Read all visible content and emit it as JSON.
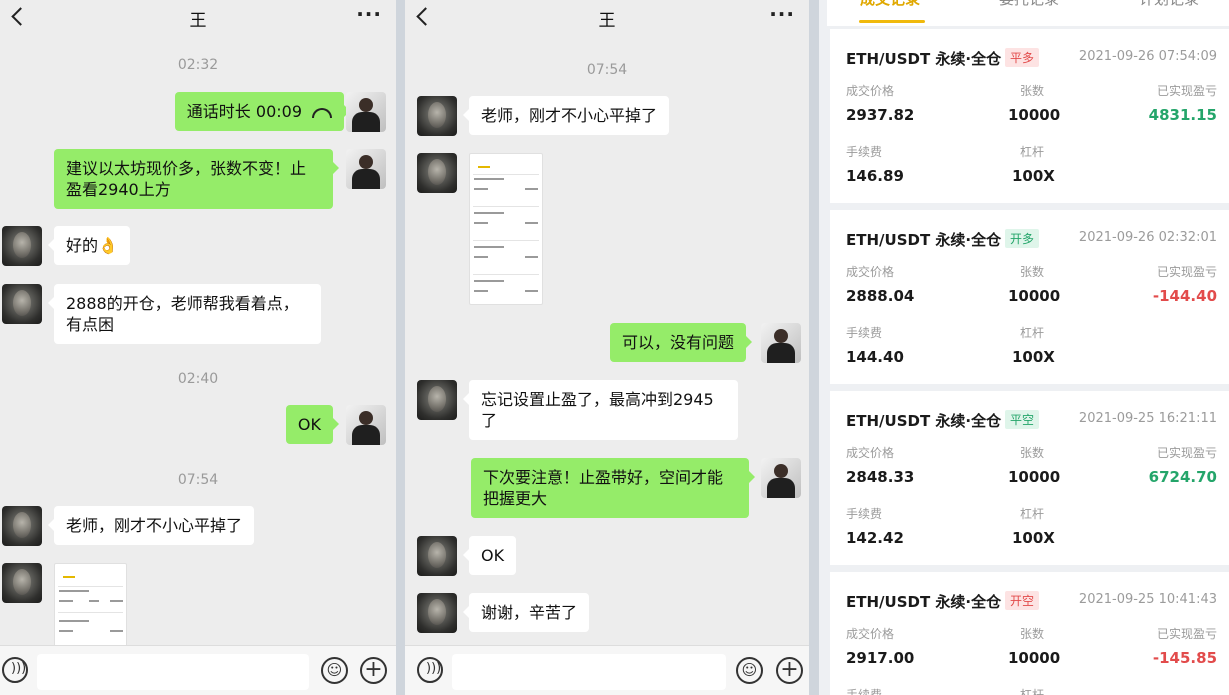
{
  "chat_left": {
    "title": "王",
    "timestamps": [
      "02:32",
      "02:40",
      "07:54"
    ],
    "messages": {
      "call": "通话时长 00:09",
      "suggest": "建议以太坊现价多，张数不变！止盈看2940上方",
      "ok_reply": "好的👌",
      "open_2888": "2888的开仓，老师帮我看着点，有点困",
      "ok": "OK",
      "closed": "老师，刚才不小心平掉了"
    }
  },
  "chat_right": {
    "title": "王",
    "timestamp": "07:54",
    "messages": {
      "closed": "老师，刚才不小心平掉了",
      "fine": "可以，没有问题",
      "forgot": "忘记设置止盈了，最高冲到2945了",
      "advice": "下次要注意！止盈带好，空间才能把握更大",
      "ok": "OK",
      "thanks": "谢谢，辛苦了"
    }
  },
  "records": {
    "tabs": [
      "成交记录",
      "委托记录",
      "计划记录"
    ],
    "labels": {
      "price": "成交价格",
      "qty": "张数",
      "pnl": "已实现盈亏",
      "fee": "手续费",
      "lev": "杠杆"
    },
    "items": [
      {
        "pair": "ETH/USDT 永续·全仓",
        "badge": "平多",
        "time": "2021-09-26 07:54:09",
        "price": "2937.82",
        "qty": "10000",
        "pnl": "4831.15",
        "fee": "146.89",
        "lev": "100X"
      },
      {
        "pair": "ETH/USDT 永续·全仓",
        "badge": "开多",
        "time": "2021-09-26 02:32:01",
        "price": "2888.04",
        "qty": "10000",
        "pnl": "-144.40",
        "fee": "144.40",
        "lev": "100X"
      },
      {
        "pair": "ETH/USDT 永续·全仓",
        "badge": "平空",
        "time": "2021-09-25 16:21:11",
        "price": "2848.33",
        "qty": "10000",
        "pnl": "6724.70",
        "fee": "142.42",
        "lev": "100X"
      },
      {
        "pair": "ETH/USDT 永续·全仓",
        "badge": "开空",
        "time": "2021-09-25 10:41:43",
        "price": "2917.00",
        "qty": "10000",
        "pnl": "-145.85",
        "fee": "手续费",
        "lev": "杠杆"
      }
    ]
  },
  "colors": {
    "outgoing_bubble": "#95ec69",
    "profit": "#24a56a",
    "loss": "#e24b4b",
    "active_tab": "#f0b90b"
  }
}
